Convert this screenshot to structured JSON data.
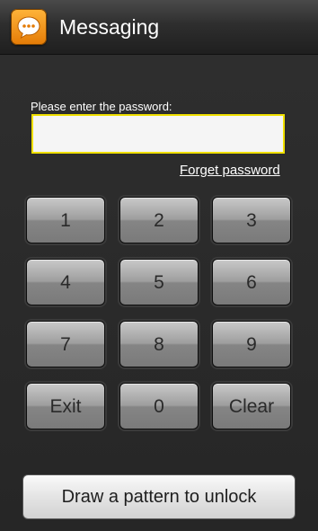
{
  "header": {
    "app_icon": "messaging-speech-bubble-icon",
    "title": "Messaging"
  },
  "password": {
    "prompt": "Please enter the password:",
    "value": "",
    "placeholder": "",
    "forget_link": "Forget password"
  },
  "keypad": {
    "keys": [
      "1",
      "2",
      "3",
      "4",
      "5",
      "6",
      "7",
      "8",
      "9",
      "Exit",
      "0",
      "Clear"
    ]
  },
  "footer": {
    "unlock_label": "Draw a pattern to unlock"
  },
  "colors": {
    "accent_input_border": "#f0e000",
    "icon_orange": "#f39a1e",
    "background": "#2b2b2b"
  }
}
